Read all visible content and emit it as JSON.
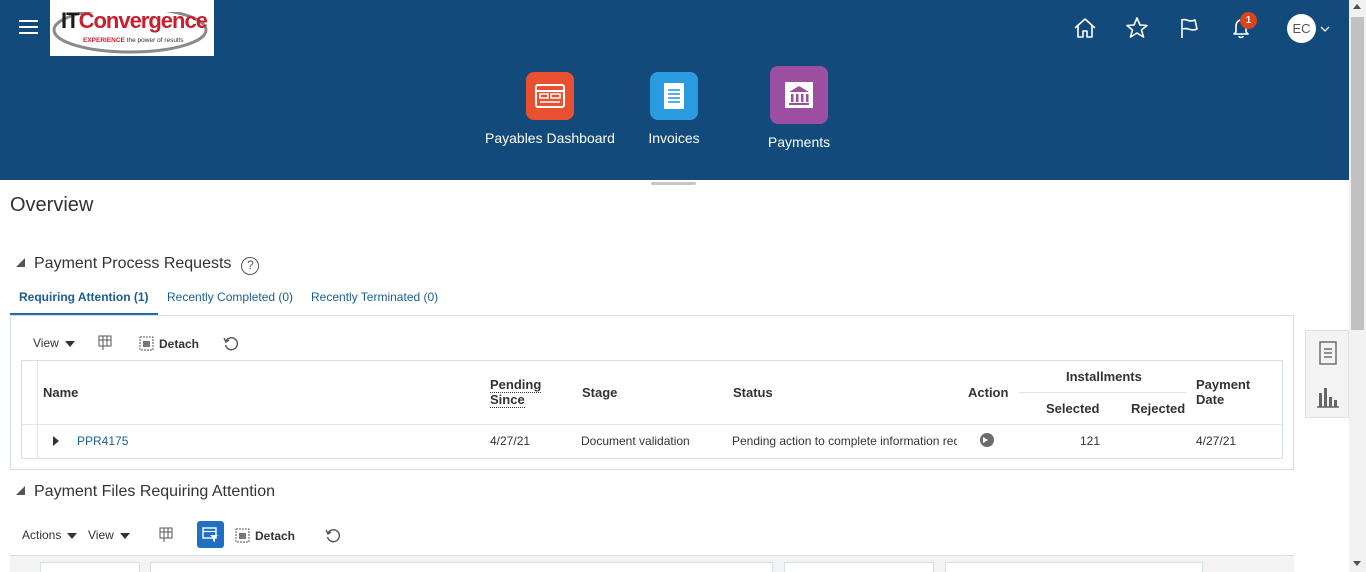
{
  "header": {
    "logo": {
      "brand_it": "IT",
      "brand_convergence": "Convergence",
      "tagline_strong": "EXPERIENCE",
      "tagline": "the power of results"
    },
    "notification_count": "1",
    "user_initials": "EC",
    "springboard": [
      {
        "label": "Payables Dashboard",
        "icon": "dashboard-icon",
        "color": "#e8502f"
      },
      {
        "label": "Invoices",
        "icon": "invoice-icon",
        "color": "#2b9be0"
      },
      {
        "label": "Payments",
        "icon": "bank-icon",
        "color": "#9c4ea1"
      }
    ]
  },
  "page": {
    "title": "Overview"
  },
  "ppr": {
    "title": "Payment Process Requests",
    "tabs": [
      {
        "label": "Requiring Attention (1)",
        "active": true
      },
      {
        "label": "Recently Completed (0)",
        "active": false
      },
      {
        "label": "Recently Terminated (0)",
        "active": false
      }
    ],
    "toolbar": {
      "view": "View",
      "detach": "Detach"
    },
    "columns": {
      "name": "Name",
      "pending_since": "Pending Since",
      "stage": "Stage",
      "status": "Status",
      "action": "Action",
      "installments": "Installments",
      "selected": "Selected",
      "rejected": "Rejected",
      "payment_date": "Payment Date"
    },
    "rows": [
      {
        "name": "PPR4175",
        "pending_since": "4/27/21",
        "stage": "Document validation",
        "status": "Pending action to complete information required",
        "selected": "121",
        "rejected": "",
        "payment_date": "4/27/21"
      }
    ]
  },
  "payment_files": {
    "title": "Payment Files Requiring Attention",
    "toolbar": {
      "actions": "Actions",
      "view": "View",
      "detach": "Detach"
    }
  },
  "colors": {
    "header_bg": "#134a7c",
    "link": "#1b5d95",
    "accent": "#1f6fc2"
  }
}
